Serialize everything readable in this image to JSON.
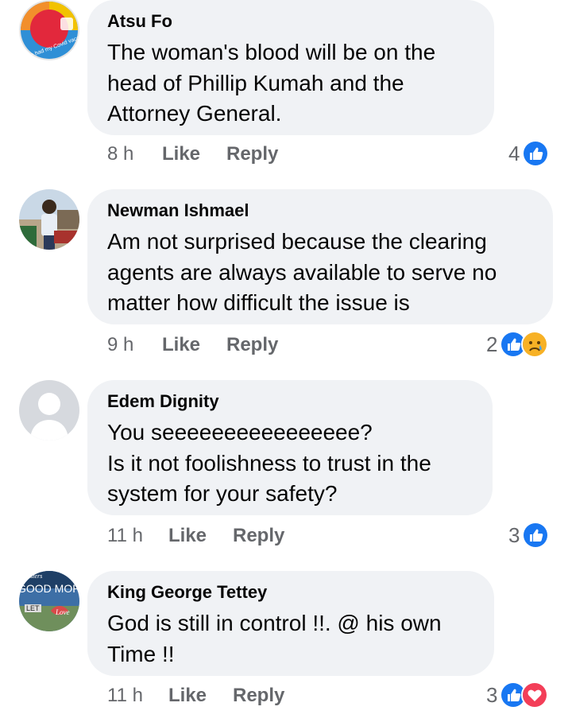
{
  "comments": [
    {
      "author": "Atsu Fo",
      "lines": [
        "The woman's blood will be on the",
        "head of Phillip Kumah and the",
        "Attorney General."
      ],
      "time": "8 h",
      "like_label": "Like",
      "reply_label": "Reply",
      "reaction_count": "4",
      "reactions": [
        "like-icon"
      ],
      "avatar_text": "I've had my Covid vaccine"
    },
    {
      "author": "Newman Ishmael",
      "lines": [
        "Am not surprised because the clearing",
        "agents are always available to serve no",
        "matter how difficult the issue is"
      ],
      "time": "9 h",
      "like_label": "Like",
      "reply_label": "Reply",
      "reaction_count": "2",
      "reactions": [
        "like-icon",
        "sad-icon"
      ]
    },
    {
      "author": "Edem Dignity",
      "lines": [
        "You seeeeeeeeeeeeeeee?",
        "Is it not foolishness to trust in the",
        "system for your safety?"
      ],
      "time": "11 h",
      "like_label": "Like",
      "reply_label": "Reply",
      "reaction_count": "3",
      "reactions": [
        "like-icon"
      ]
    },
    {
      "author": "King George Tettey",
      "lines": [
        "God is still in control !!. @ his own",
        "Time !!"
      ],
      "time": "11 h",
      "like_label": "Like",
      "reply_label": "Reply",
      "reaction_count": "3",
      "reactions": [
        "like-icon",
        "love-icon"
      ],
      "avatar_text": [
        "Sisters",
        "GOOD MOR",
        "LET",
        "Love"
      ]
    }
  ],
  "colors": {
    "bubble": "#f0f2f5",
    "meta": "#65676b",
    "like": "#1877f2",
    "love": "#f33e58",
    "sad": "#f7b125"
  }
}
